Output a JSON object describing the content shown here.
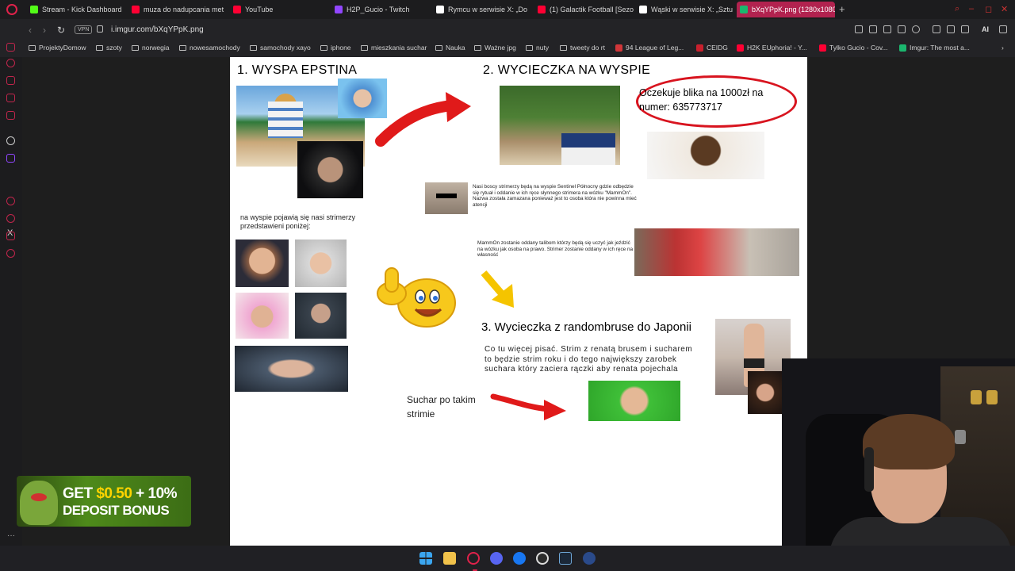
{
  "browser": {
    "tabs": [
      {
        "title": "Stream - Kick Dashboard",
        "favicon_color": "#53fc18"
      },
      {
        "title": "muza do nadupcania met",
        "favicon_color": "#ff0033"
      },
      {
        "title": "YouTube",
        "favicon_color": "#ff0033"
      },
      {
        "title": "H2P_Gucio - Twitch",
        "favicon_color": "#9146ff"
      },
      {
        "title": "Rymcu w serwisie X: „Do",
        "favicon_color": "#ffffff"
      },
      {
        "title": "(1) Galactik Football [Sezo",
        "favicon_color": "#ff0033"
      },
      {
        "title": "Wąski w serwisie X: „Sztu",
        "favicon_color": "#ffffff"
      },
      {
        "title": "bXqYPpK.png (1280x1080",
        "favicon_color": "#1bb76e"
      }
    ],
    "new_tab": "+",
    "url": "i.imgur.com/bXqYPpK.png",
    "vpn_label": "VPN",
    "ai_label": "AI",
    "bookmarks": [
      {
        "label": "ProjektyDomow",
        "type": "folder"
      },
      {
        "label": "szoty",
        "type": "folder"
      },
      {
        "label": "norwegia",
        "type": "folder"
      },
      {
        "label": "nowesamochody",
        "type": "folder"
      },
      {
        "label": "samochody xayo",
        "type": "folder"
      },
      {
        "label": "iphone",
        "type": "folder"
      },
      {
        "label": "mieszkania suchar",
        "type": "folder"
      },
      {
        "label": "Nauka",
        "type": "folder"
      },
      {
        "label": "Ważne jpg",
        "type": "folder"
      },
      {
        "label": "nuty",
        "type": "folder"
      },
      {
        "label": "tweety do rt",
        "type": "folder"
      },
      {
        "label": "94 League of Leg...",
        "type": "site",
        "color": "#d13639"
      },
      {
        "label": "CEIDG",
        "type": "site",
        "color": "#c8202d"
      },
      {
        "label": "H2K EUphoria! - Y...",
        "type": "site",
        "color": "#ff0033"
      },
      {
        "label": "Tylko Gucio - Cov...",
        "type": "site",
        "color": "#ff0033"
      },
      {
        "label": "Imgur: The most a...",
        "type": "site",
        "color": "#1bb76e"
      }
    ]
  },
  "image": {
    "section1_title": "1. WYSPA EPSTINA",
    "section2_title": "2. WYCIECZKA NA WYSPIE",
    "section3_title": "3. Wycieczka z randombruse do Japonii",
    "blik_text": "Oczekuje blika na 1000zł na numer: 635773717",
    "streamers_intro": "na wyspie pojawią się nasi strimerzy przedstawieni poniżej:",
    "paragraph1": "Nasi boscy strimerzy będą na wyspie Sentinel Północny gdzie odbędzie się rytuał i oddanie w ich ręce słynnego strimera na wózku \"MammOn\". Nazwa została zamazana ponieważ jest to osoba która nie powinna mieć atencji",
    "paragraph2": "MammOn zostanie oddany talibom którzy będą się uczyć jak jeździć na wózku jak osoba na prawo. Strimer zostanie oddany w ich ręce na własność",
    "paragraph3": "Co tu więcej pisać. Strim z renatą brusem i sucharem to będzie strim roku i do tego największy zarobek suchara który zaciera rączki aby renata pojechala",
    "suchar_caption": "Suchar po takim strimie"
  },
  "ad": {
    "amount": "$0.50",
    "line1_prefix": "GET",
    "line1_suffix": "+ 10%",
    "line2": "DEPOSIT BONUS"
  },
  "taskbar": {
    "apps": [
      "windows-start",
      "file-explorer",
      "opera-browser",
      "discord",
      "facebook",
      "obs-studio",
      "steam",
      "app"
    ]
  },
  "colors": {
    "accent": "#e0224b",
    "arrow_red": "#e01a1a",
    "arrow_yellow": "#f5c400",
    "oval_red": "#d8141f"
  }
}
